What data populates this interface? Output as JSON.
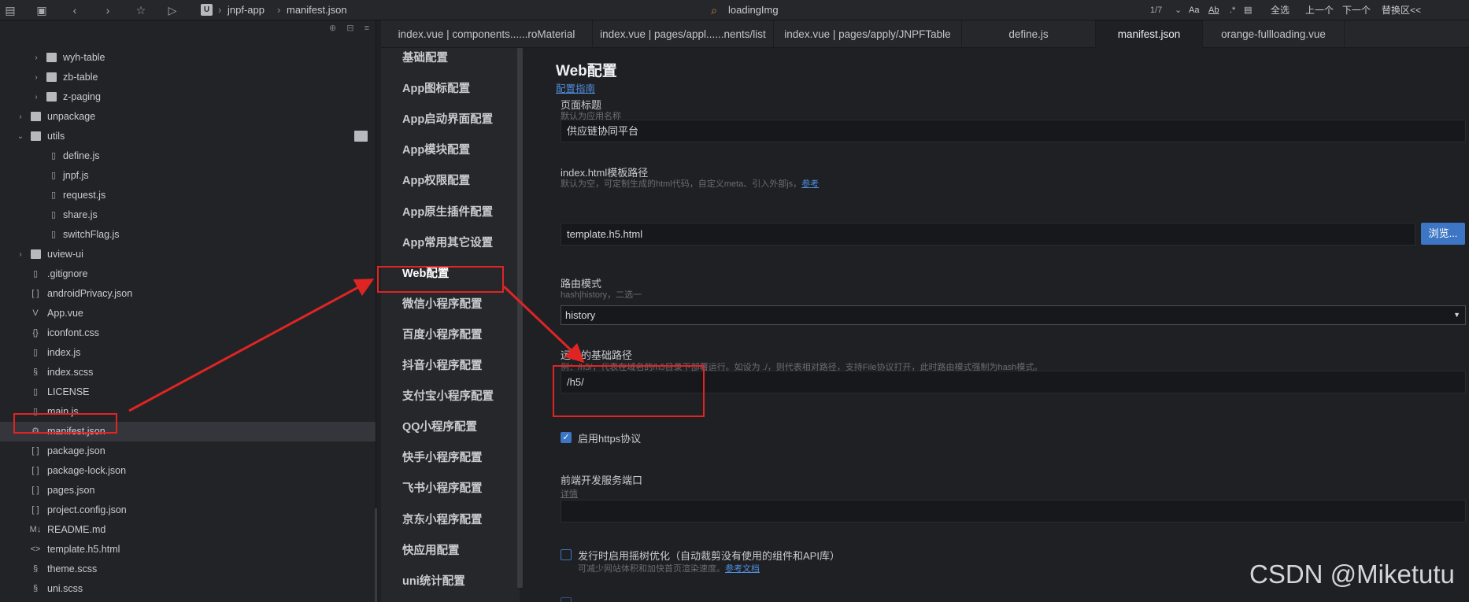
{
  "toolbar": {
    "project": "jnpf-app",
    "file": "manifest.json",
    "search_value": "loadingImg",
    "match_count": "1/7",
    "opt_case": "Aa",
    "opt_word": "Ab",
    "opt_select_all": "全选",
    "opt_prev": "上一个",
    "opt_next": "下一个",
    "opt_replace": "替换区<<"
  },
  "sidebar": {
    "items": [
      {
        "label": "wyh-table",
        "kind": "folder",
        "indent": 2,
        "arrow": "›"
      },
      {
        "label": "zb-table",
        "kind": "folder",
        "indent": 2,
        "arrow": "›"
      },
      {
        "label": "z-paging",
        "kind": "folder",
        "indent": 2,
        "arrow": "›"
      },
      {
        "label": "unpackage",
        "kind": "folder",
        "indent": 1,
        "arrow": "›"
      },
      {
        "label": "utils",
        "kind": "folder-open",
        "indent": 1,
        "arrow": "⌄"
      },
      {
        "label": "define.js",
        "kind": "file",
        "indent": 2,
        "glyph": "▯"
      },
      {
        "label": "jnpf.js",
        "kind": "file",
        "indent": 2,
        "glyph": "▯"
      },
      {
        "label": "request.js",
        "kind": "file",
        "indent": 2,
        "glyph": "▯"
      },
      {
        "label": "share.js",
        "kind": "file",
        "indent": 2,
        "glyph": "▯"
      },
      {
        "label": "switchFlag.js",
        "kind": "file",
        "indent": 2,
        "glyph": "▯"
      },
      {
        "label": "uview-ui",
        "kind": "folder",
        "indent": 1,
        "arrow": "›"
      },
      {
        "label": ".gitignore",
        "kind": "file",
        "indent": 1,
        "glyph": "▯"
      },
      {
        "label": "androidPrivacy.json",
        "kind": "file",
        "indent": 1,
        "glyph": "[ ]"
      },
      {
        "label": "App.vue",
        "kind": "file",
        "indent": 1,
        "glyph": "V"
      },
      {
        "label": "iconfont.css",
        "kind": "file",
        "indent": 1,
        "glyph": "{}"
      },
      {
        "label": "index.js",
        "kind": "file",
        "indent": 1,
        "glyph": "▯"
      },
      {
        "label": "index.scss",
        "kind": "file",
        "indent": 1,
        "glyph": "§"
      },
      {
        "label": "LICENSE",
        "kind": "file",
        "indent": 1,
        "glyph": "▯"
      },
      {
        "label": "main.js",
        "kind": "file",
        "indent": 1,
        "glyph": "▯"
      },
      {
        "label": "manifest.json",
        "kind": "file",
        "indent": 1,
        "glyph": "⚙",
        "selected": true
      },
      {
        "label": "package.json",
        "kind": "file",
        "indent": 1,
        "glyph": "[ ]"
      },
      {
        "label": "package-lock.json",
        "kind": "file",
        "indent": 1,
        "glyph": "[ ]"
      },
      {
        "label": "pages.json",
        "kind": "file",
        "indent": 1,
        "glyph": "[ ]"
      },
      {
        "label": "project.config.json",
        "kind": "file",
        "indent": 1,
        "glyph": "[ ]"
      },
      {
        "label": "README.md",
        "kind": "file",
        "indent": 1,
        "glyph": "M↓"
      },
      {
        "label": "template.h5.html",
        "kind": "file",
        "indent": 1,
        "glyph": "<>"
      },
      {
        "label": "theme.scss",
        "kind": "file",
        "indent": 1,
        "glyph": "§"
      },
      {
        "label": "uni.scss",
        "kind": "file",
        "indent": 1,
        "glyph": "§"
      }
    ]
  },
  "tabs": [
    {
      "label": "index.vue | components......roMaterial"
    },
    {
      "label": "index.vue | pages/appl......nents/list"
    },
    {
      "label": "index.vue | pages/apply/JNPFTable"
    },
    {
      "label": "define.js"
    },
    {
      "label": "manifest.json",
      "active": true
    },
    {
      "label": "orange-fullloading.vue"
    }
  ],
  "nav": {
    "items": [
      {
        "label": "基础配置"
      },
      {
        "label": "App图标配置"
      },
      {
        "label": "App启动界面配置"
      },
      {
        "label": "App模块配置"
      },
      {
        "label": "App权限配置"
      },
      {
        "label": "App原生插件配置"
      },
      {
        "label": "App常用其它设置"
      },
      {
        "label": "Web配置",
        "active": true
      },
      {
        "label": "微信小程序配置"
      },
      {
        "label": "百度小程序配置"
      },
      {
        "label": "抖音小程序配置"
      },
      {
        "label": "支付宝小程序配置"
      },
      {
        "label": "QQ小程序配置"
      },
      {
        "label": "快手小程序配置"
      },
      {
        "label": "飞书小程序配置"
      },
      {
        "label": "京东小程序配置"
      },
      {
        "label": "快应用配置"
      },
      {
        "label": "uni统计配置"
      }
    ]
  },
  "main": {
    "title": "Web配置",
    "guide_link": "配置指南",
    "page_title_label": "页面标题",
    "page_title_hint": "默认为应用名称",
    "page_title_value": "供应链协同平台",
    "template_label": "index.html模板路径",
    "template_hint": "默认为空，可定制生成的html代码，自定义meta、引入外部js，",
    "template_hint_link": "参考",
    "template_value": "template.h5.html",
    "browse_label": "浏览...",
    "router_label": "路由模式",
    "router_hint": "hash|history，二选一",
    "router_value": "history",
    "base_label": "运行的基础路径",
    "base_hint": "例：/h5/，代表在域名的/h5目录下部署运行。如设为 ./，则代表相对路径，支持File协议打开，此时路由模式强制为hash模式。",
    "base_value": "/h5/",
    "https_label": "启用https协议",
    "https_checked": true,
    "devport_label": "前端开发服务端口",
    "devport_link": "详情",
    "devport_value": "",
    "treeshake_label": "发行时启用摇树优化（自动裁剪没有使用的组件和API库）",
    "treeshake_hint": "可减少网站体积和加快首页渲染速度。",
    "treeshake_link": "参考文档",
    "treeshake_checked": false
  },
  "watermark": "CSDN @Miketutu",
  "colors": {
    "annotation": "#e02424",
    "accent": "#3d76c4",
    "link": "#4f8fde"
  }
}
